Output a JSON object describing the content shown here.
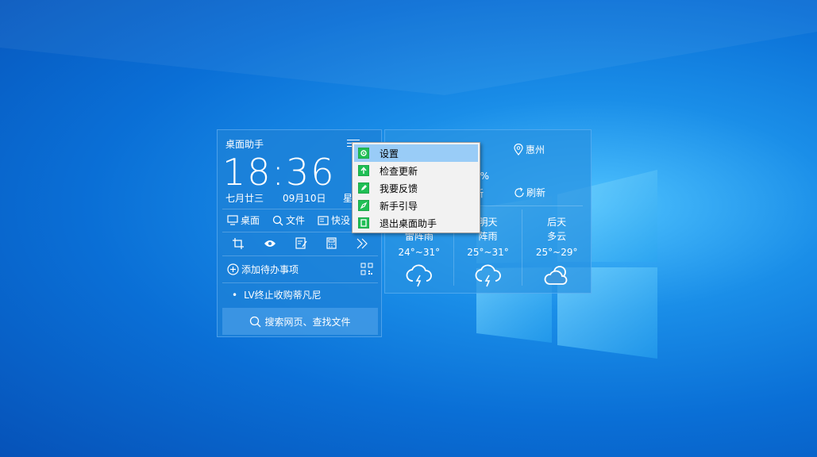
{
  "widget_left": {
    "title": "桌面助手",
    "clock": "18:36 0",
    "lunar": "七月廿三",
    "date": "09月10日",
    "weekday": "星",
    "quick": [
      {
        "label": "桌面",
        "icon": "monitor-icon"
      },
      {
        "label": "文件",
        "icon": "search-icon"
      },
      {
        "label": "快没",
        "icon": "card-icon"
      }
    ],
    "tools": [
      "crop-icon",
      "eye-icon",
      "note-icon",
      "calculator-icon",
      "chevron-double-right-icon"
    ],
    "todo_add": "添加待办事项",
    "news_bullet": "•",
    "news": "LV终止收购蒂凡尼",
    "search": "搜索网页、查找文件"
  },
  "widget_right": {
    "location": "惠州",
    "humidity": "0%",
    "update": "新",
    "refresh": "刷新",
    "days": [
      {
        "name": "",
        "weather": "雷阵雨",
        "temp": "24°~31°",
        "icon": "thunderstorm-icon"
      },
      {
        "name": "明天",
        "weather": "阵雨",
        "temp": "25°~31°",
        "icon": "thunderstorm-icon"
      },
      {
        "name": "后天",
        "weather": "多云",
        "temp": "25°~29°",
        "icon": "cloudy-icon"
      }
    ]
  },
  "context_menu": {
    "items": [
      {
        "label": "设置",
        "icon": "gear-icon"
      },
      {
        "label": "检查更新",
        "icon": "upload-icon"
      },
      {
        "label": "我要反馈",
        "icon": "edit-icon"
      },
      {
        "label": "新手引导",
        "icon": "compass-icon"
      },
      {
        "label": "退出桌面助手",
        "icon": "exit-icon"
      }
    ]
  },
  "colors": {
    "accent_green": "#1fbf55",
    "menu_hover": "#99ccf7",
    "desktop_blue": "#0a6fd6"
  }
}
